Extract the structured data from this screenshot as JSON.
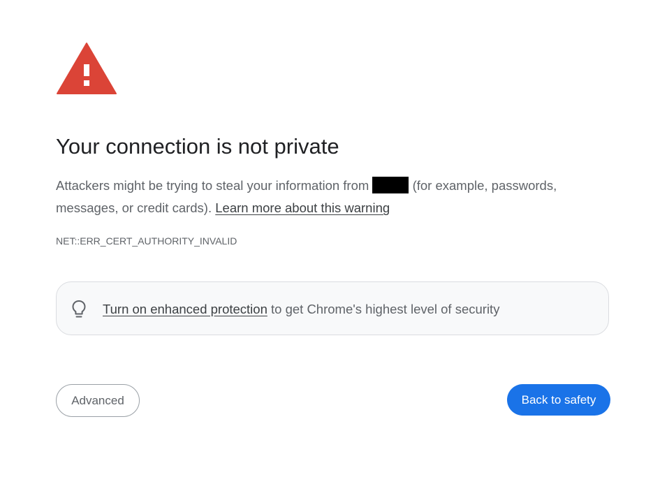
{
  "colors": {
    "warning_red": "#DB4437",
    "primary_blue": "#1A73E8",
    "text_primary": "#202124",
    "text_secondary": "#5F6368",
    "promo_background": "#F8F9FA"
  },
  "icons": {
    "warning": "warning-triangle-icon",
    "promo": "lightbulb-icon"
  },
  "main": {
    "title": "Your connection is not private",
    "explanation_before": "Attackers might be trying to steal your information from",
    "explanation_after": "(for example, passwords, messages, or credit cards).",
    "learn_more_link": "Learn more about this warning",
    "error_code": "NET::ERR_CERT_AUTHORITY_INVALID"
  },
  "promo": {
    "link_text": "Turn on enhanced protection",
    "suffix_text": "to get Chrome's highest level of security"
  },
  "buttons": {
    "advanced_label": "Advanced",
    "back_label": "Back to safety"
  }
}
